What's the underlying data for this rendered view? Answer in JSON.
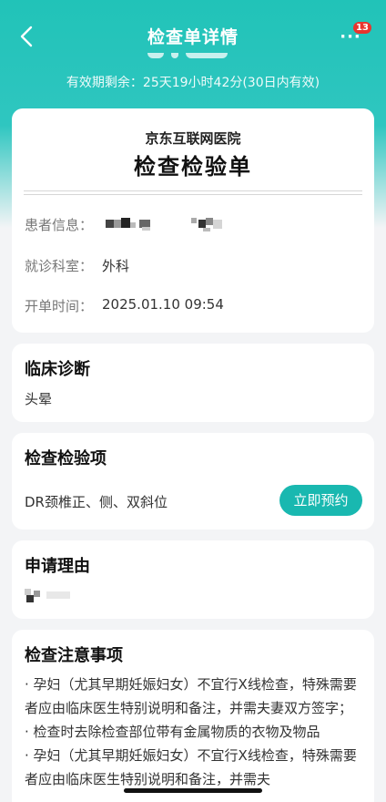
{
  "header": {
    "title": "检查单详情",
    "more_label": "···",
    "badge_count": "13",
    "validity": "有效期剩余：25天19小时42分(30日内有效)"
  },
  "form": {
    "hospital": "京东互联网医院",
    "title": "检查检验单",
    "rows": [
      {
        "label": "患者信息：",
        "value": ""
      },
      {
        "label": "就诊科室：",
        "value": "外科"
      },
      {
        "label": "开单时间：",
        "value": "2025.01.10 09:54"
      }
    ]
  },
  "diagnosis": {
    "title": "临床诊断",
    "text": "头晕"
  },
  "items": {
    "title": "检查检验项",
    "name": "DR颈椎正、侧、双斜位",
    "book_label": "立即预约"
  },
  "reason": {
    "title": "申请理由"
  },
  "notice": {
    "title": "检查注意事项",
    "lines": [
      "· 孕妇（尤其早期妊娠妇女）不宜行X线检查，特殊需要者应由临床医生特别说明和备注，并需夫妻双方签字；",
      "· 检查时去除检查部位带有金属物质的衣物及物品",
      "· 孕妇（尤其早期妊娠妇女）不宜行X线检查，特殊需要者应由临床医生特别说明和备注，并需夫"
    ]
  },
  "colors": {
    "accent": "#19b8b0",
    "header_gradient_top": "#21c3b8",
    "badge": "#e8352e",
    "page_bg": "#f3f4f6"
  },
  "icons": {
    "back": "chevron-left-icon",
    "more": "more-dots-icon"
  }
}
